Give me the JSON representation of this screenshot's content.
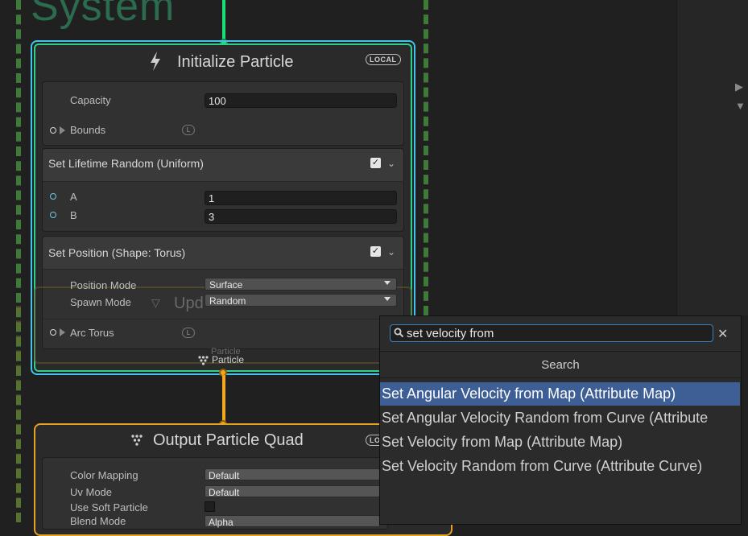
{
  "background": {
    "system_label": "System"
  },
  "initialize_context": {
    "title": "Initialize Particle",
    "badge": "LOCAL",
    "footer_label": "Particle",
    "fields": {
      "capacity_label": "Capacity",
      "capacity_value": "100",
      "bounds_label": "Bounds",
      "bounds_badge": "L"
    },
    "blocks": [
      {
        "title": "Set Lifetime Random (Uniform)",
        "enabled": true,
        "a_label": "A",
        "a_value": "1",
        "b_label": "B",
        "b_value": "3"
      },
      {
        "title": "Set Position (Shape: Torus)",
        "enabled": true,
        "position_mode_label": "Position Mode",
        "position_mode_value": "Surface",
        "spawn_mode_label": "Spawn Mode",
        "spawn_mode_value": "Random",
        "arc_torus_label": "Arc Torus",
        "arc_torus_badge": "L"
      }
    ]
  },
  "update_ghost": {
    "title": "Upd",
    "footer_label": "Particle"
  },
  "output_context": {
    "title": "Output Particle Quad",
    "badge": "LO",
    "rows": [
      {
        "label": "Color Mapping",
        "value": "Default"
      },
      {
        "label": "Uv Mode",
        "value": "Default"
      },
      {
        "label": "Use Soft Particle",
        "value": ""
      },
      {
        "label": "Blend Mode",
        "value": "Alpha"
      }
    ]
  },
  "search": {
    "query": "set velocity from",
    "header": "Search",
    "results": [
      {
        "label": "Set Angular Velocity from Map (Attribute Map)",
        "selected": true
      },
      {
        "label": "Set Angular Velocity Random from Curve (Attribute",
        "selected": false
      },
      {
        "label": "Set Velocity from Map (Attribute Map)",
        "selected": false
      },
      {
        "label": "Set Velocity Random from Curve (Attribute Curve)",
        "selected": false
      }
    ]
  },
  "colors": {
    "spawn_flow": "#19e07a",
    "update_flow": "#f2a71f",
    "init_border": "#45c2ee",
    "selection": "#3e5f96"
  }
}
